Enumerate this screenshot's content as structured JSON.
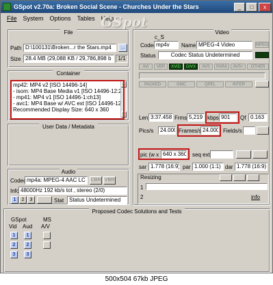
{
  "titlebar": {
    "title": "GSpot v2.70a: Broken Social Scene - Churches Under the Stars",
    "minimize": "_",
    "maximize": "□",
    "close": "x"
  },
  "menu": [
    "File",
    "System",
    "Options",
    "Tables",
    "Help"
  ],
  "logo": "GSpot",
  "file": {
    "section": "File",
    "path_label": "Path",
    "path_value": "D:\\100131\\Broken...r the Stars.mp4",
    "browse": "...",
    "size_label": "Size",
    "size_value": "28.4 MB (29,088 KB / 29,786,898 b",
    "page": "1/1"
  },
  "container": {
    "section": "Container",
    "lines": [
      "mp42: MP4 v2 [ISO 14496-14]",
      "- isom: MP4  Base Media v1 [ISO 14496-12:20",
      "- mp41: MP4 v1 [ISO 14496-1:ch13]",
      "- avc1: MP4 Base w/ AVC ext [ISO 14496-12:20",
      "Recommended Display Size: 640 x 360"
    ]
  },
  "userdata": {
    "section": "User Data / Metadata"
  },
  "audio": {
    "section": "Audio",
    "codec_label": "Codec",
    "codec_value": "mp4a: MPEG-4 AAC LC",
    "btns": [
      "CBR",
      "VBR"
    ],
    "info_label": "Info",
    "info_value": "48000Hz  192 kb/s tot , stereo (2/0)",
    "stat_label": "Stat",
    "stat_value": "Status Undetermined",
    "tracks": [
      "1",
      "2",
      "3"
    ]
  },
  "codec_solutions": {
    "section": "Proposed Codec Solutions and Tests",
    "gspot": "GSpot",
    "ms": "MS",
    "vid": "Vid",
    "aud": "Aud",
    "av": "A/V",
    "vid_rows": [
      "1",
      "2",
      "3"
    ],
    "aud_rows": [
      "1",
      "2",
      "3"
    ]
  },
  "video": {
    "section": "Video",
    "cs_label": "c_S",
    "codec_label": "Codec",
    "codec_value": "mp4v",
    "name_label": "Name",
    "name_value": "MPEG-4 Video",
    "mpeg_btn": "MPEG",
    "status_label": "Status",
    "status_value": "Codec Status Undetermined",
    "leds_top": [
      "AVI",
      "VBR",
      "XVID",
      "DIVX",
      "AVS",
      "PARA",
      "AVS+",
      "OTHER"
    ],
    "leds_bottom": [
      "PACKED",
      "GMC",
      "QPEL",
      "INTER"
    ],
    "len_label": "Len",
    "len_value": "3:37.458",
    "frms_label": "Frms",
    "frms_value": "5,219",
    "kbps_label": "kbps",
    "kbps_value": "901",
    "qf_label": "Qf",
    "qf_value": "0.163",
    "pics_label": "Pics/s",
    "pics_value": "24.000",
    "frames_label": "Frames/s",
    "frames_value": "24.000",
    "fields_label": "Fields/s",
    "pic_label": "pic (w x",
    "pic_value": "640 x 360",
    "seq_label": "seq ext",
    "sar_label": "sar",
    "sar_value": "1.778 (16:9)",
    "par_label": "par",
    "par_value": "1.000 (1:1)",
    "dar_label": "dar",
    "dar_value": "1.778 (16:9)",
    "resizing_label": "Resizing",
    "info_link": "info",
    "row1": "1",
    "row2": "2"
  },
  "caption": "500x504 67kb JPEG"
}
